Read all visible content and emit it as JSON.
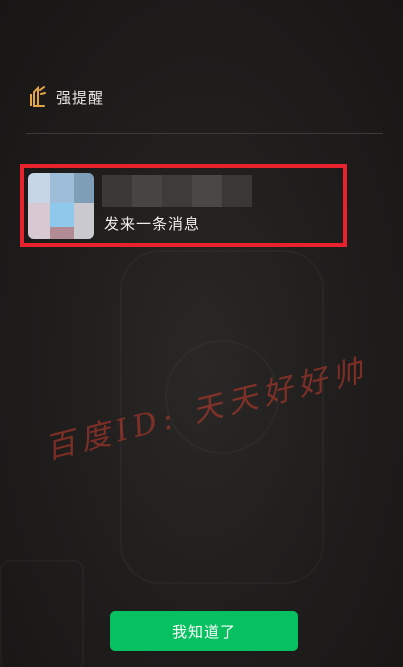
{
  "header": {
    "icon": "bell-icon",
    "title": "强提醒"
  },
  "message": {
    "text": "发来一条消息",
    "avatar_icon": "avatar-blurred",
    "sender_name_blurred": true
  },
  "watermark": {
    "text": "百度ID: 天天好好帅"
  },
  "actions": {
    "confirm_label": "我知道了"
  },
  "colors": {
    "accent_green": "#07c160",
    "highlight_red": "#e8232d",
    "background": "#1d1b1a"
  }
}
